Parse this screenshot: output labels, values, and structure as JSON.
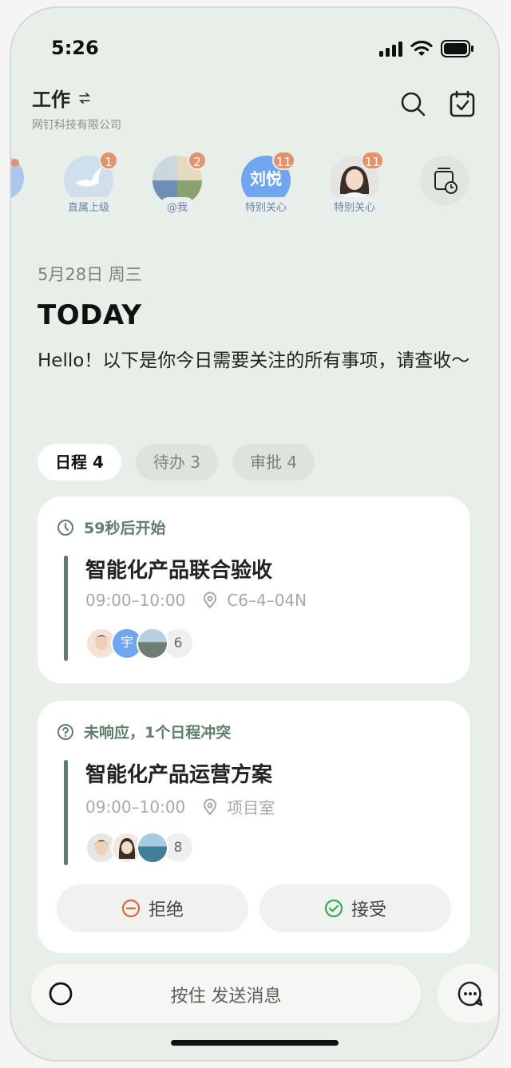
{
  "status": {
    "time": "5:26"
  },
  "header": {
    "title": "工作",
    "subtitle": "网钉科技有限公司"
  },
  "stories": [
    {
      "label": "直属上级",
      "badge": "1",
      "avatar": "bird"
    },
    {
      "label": "@我",
      "badge": "2",
      "avatar": "group"
    },
    {
      "label": "特别关心",
      "badge": "11",
      "avatar": "text",
      "avatar_text": "刘悦"
    },
    {
      "label": "特别关心",
      "badge": "11",
      "avatar": "woman"
    }
  ],
  "date": "5月28日 周三",
  "today_title": "TODAY",
  "greeting": "Hello！以下是你今日需要关注的所有事项，请查收～",
  "tabs": [
    {
      "label": "日程 4",
      "active": true
    },
    {
      "label": "待办 3",
      "active": false
    },
    {
      "label": "审批 4",
      "active": false
    }
  ],
  "events": [
    {
      "status": "59秒后开始",
      "title": "智能化产品联合验收",
      "time": "09:00–10:00",
      "location": "C6–4–04N",
      "participant_count": "6",
      "avatar_text": "宇"
    },
    {
      "status": "未响应，1个日程冲突",
      "title": "智能化产品运营方案",
      "time": "09:00–10:00",
      "location": "项目室",
      "participant_count": "8",
      "reject_label": "拒绝",
      "accept_label": "接受"
    }
  ],
  "bottom_bar": {
    "label": "按住 发送消息"
  },
  "colors": {
    "accent": "#5e7d6c",
    "badge": "#e3936c",
    "reject": "#e8603c",
    "accept": "#3fa55a"
  }
}
